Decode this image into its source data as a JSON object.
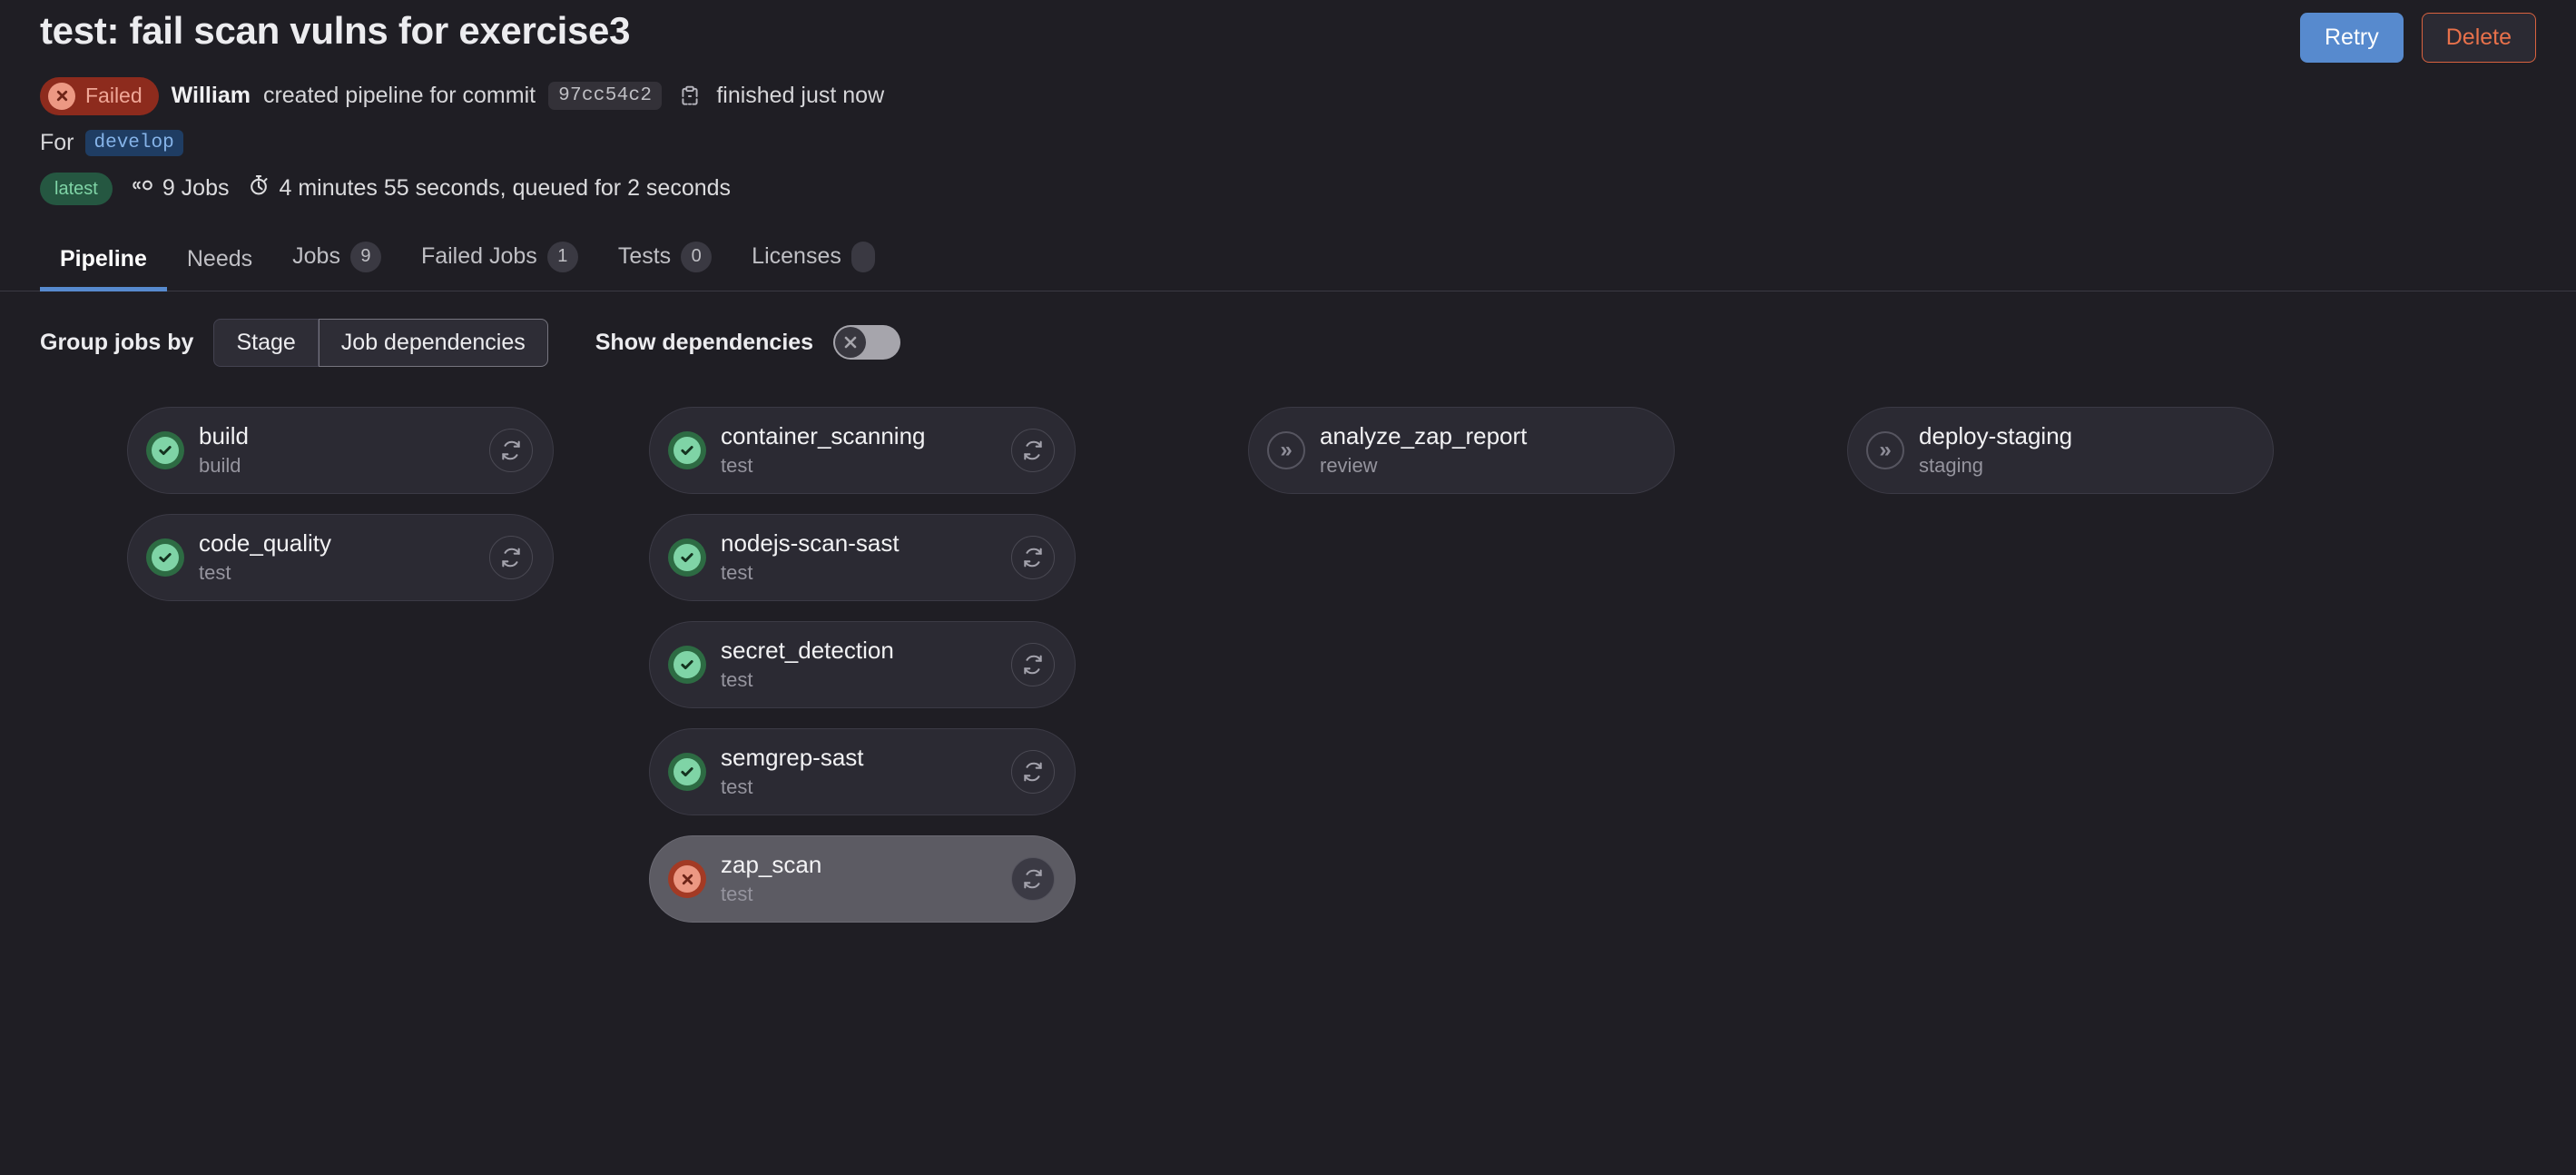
{
  "header": {
    "title": "test: fail scan vulns for exercise3",
    "retry_label": "Retry",
    "delete_label": "Delete",
    "status_label": "Failed",
    "status_color": "#8d2b1d",
    "author": "William",
    "created_text": "created pipeline for commit",
    "commit_sha": "97cc54c2",
    "finished_text": "finished just now",
    "for_label": "For",
    "branch": "develop",
    "latest_label": "latest",
    "jobs_count_text": "9 Jobs",
    "duration_text": "4 minutes 55 seconds, queued for 2 seconds",
    "copy_icon": "copy-icon",
    "jobs_icon": "pipeline-nodes-icon",
    "timer_icon": "stopwatch-icon"
  },
  "tabs": [
    {
      "label": "Pipeline",
      "badge": null,
      "active": true
    },
    {
      "label": "Needs",
      "badge": null,
      "active": false
    },
    {
      "label": "Jobs",
      "badge": "9",
      "active": false
    },
    {
      "label": "Failed Jobs",
      "badge": "1",
      "active": false
    },
    {
      "label": "Tests",
      "badge": "0",
      "active": false
    },
    {
      "label": "Licenses",
      "badge": "",
      "active": false
    }
  ],
  "controls": {
    "group_jobs_by_label": "Group jobs by",
    "stage_label": "Stage",
    "job_dependencies_label": "Job dependencies",
    "selected_group": "Job dependencies",
    "show_dependencies_label": "Show dependencies",
    "show_dependencies_on": false,
    "toggle_icon": "close-x-icon"
  },
  "accent_colors": {
    "primary_blue": "#578ace",
    "success_green": "#7fd4a6",
    "failed_red": "#ec9883",
    "skipped_gray": "#8f8e99",
    "page_background": "#1f1e24"
  },
  "graph": {
    "columns": [
      {
        "jobs": [
          {
            "name": "build",
            "stage": "build",
            "status": "success",
            "has_action": true,
            "hovered": false
          },
          {
            "name": "code_quality",
            "stage": "test",
            "status": "success",
            "has_action": true,
            "hovered": false
          }
        ]
      },
      {
        "jobs": [
          {
            "name": "container_scanning",
            "stage": "test",
            "status": "success",
            "has_action": true,
            "hovered": false
          },
          {
            "name": "nodejs-scan-sast",
            "stage": "test",
            "status": "success",
            "has_action": true,
            "hovered": false
          },
          {
            "name": "secret_detection",
            "stage": "test",
            "status": "success",
            "has_action": true,
            "hovered": false
          },
          {
            "name": "semgrep-sast",
            "stage": "test",
            "status": "success",
            "has_action": true,
            "hovered": false
          },
          {
            "name": "zap_scan",
            "stage": "test",
            "status": "failed",
            "has_action": true,
            "hovered": true
          }
        ]
      },
      {
        "jobs": [
          {
            "name": "analyze_zap_report",
            "stage": "review",
            "status": "skipped",
            "has_action": false,
            "hovered": false
          }
        ]
      },
      {
        "jobs": [
          {
            "name": "deploy-staging",
            "stage": "staging",
            "status": "skipped",
            "has_action": false,
            "hovered": false
          }
        ]
      }
    ]
  }
}
